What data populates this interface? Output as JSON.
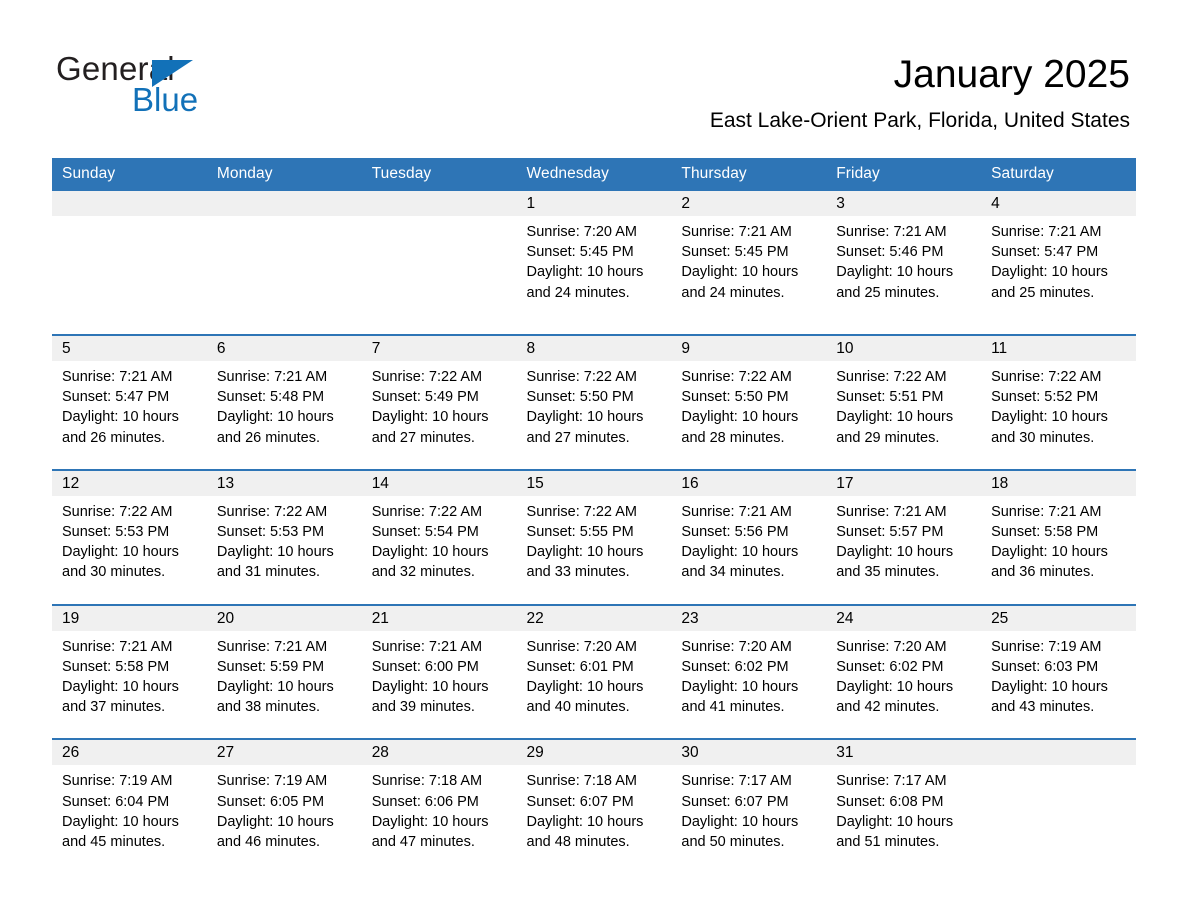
{
  "brand": {
    "name_part1": "General",
    "name_part2": "Blue",
    "accent_color": "#1271b8",
    "triangle_icon": "logo-triangle-icon"
  },
  "header": {
    "title": "January 2025",
    "location": "East Lake-Orient Park, Florida, United States"
  },
  "calendar": {
    "header_bg": "#2e75b6",
    "daynum_bg": "#f0f0f0",
    "columns": [
      "Sunday",
      "Monday",
      "Tuesday",
      "Wednesday",
      "Thursday",
      "Friday",
      "Saturday"
    ],
    "weeks": [
      [
        {
          "day": "",
          "lines": []
        },
        {
          "day": "",
          "lines": []
        },
        {
          "day": "",
          "lines": []
        },
        {
          "day": "1",
          "lines": [
            "Sunrise: 7:20 AM",
            "Sunset: 5:45 PM",
            "Daylight: 10 hours",
            "and 24 minutes."
          ]
        },
        {
          "day": "2",
          "lines": [
            "Sunrise: 7:21 AM",
            "Sunset: 5:45 PM",
            "Daylight: 10 hours",
            "and 24 minutes."
          ]
        },
        {
          "day": "3",
          "lines": [
            "Sunrise: 7:21 AM",
            "Sunset: 5:46 PM",
            "Daylight: 10 hours",
            "and 25 minutes."
          ]
        },
        {
          "day": "4",
          "lines": [
            "Sunrise: 7:21 AM",
            "Sunset: 5:47 PM",
            "Daylight: 10 hours",
            "and 25 minutes."
          ]
        }
      ],
      [
        {
          "day": "5",
          "lines": [
            "Sunrise: 7:21 AM",
            "Sunset: 5:47 PM",
            "Daylight: 10 hours",
            "and 26 minutes."
          ]
        },
        {
          "day": "6",
          "lines": [
            "Sunrise: 7:21 AM",
            "Sunset: 5:48 PM",
            "Daylight: 10 hours",
            "and 26 minutes."
          ]
        },
        {
          "day": "7",
          "lines": [
            "Sunrise: 7:22 AM",
            "Sunset: 5:49 PM",
            "Daylight: 10 hours",
            "and 27 minutes."
          ]
        },
        {
          "day": "8",
          "lines": [
            "Sunrise: 7:22 AM",
            "Sunset: 5:50 PM",
            "Daylight: 10 hours",
            "and 27 minutes."
          ]
        },
        {
          "day": "9",
          "lines": [
            "Sunrise: 7:22 AM",
            "Sunset: 5:50 PM",
            "Daylight: 10 hours",
            "and 28 minutes."
          ]
        },
        {
          "day": "10",
          "lines": [
            "Sunrise: 7:22 AM",
            "Sunset: 5:51 PM",
            "Daylight: 10 hours",
            "and 29 minutes."
          ]
        },
        {
          "day": "11",
          "lines": [
            "Sunrise: 7:22 AM",
            "Sunset: 5:52 PM",
            "Daylight: 10 hours",
            "and 30 minutes."
          ]
        }
      ],
      [
        {
          "day": "12",
          "lines": [
            "Sunrise: 7:22 AM",
            "Sunset: 5:53 PM",
            "Daylight: 10 hours",
            "and 30 minutes."
          ]
        },
        {
          "day": "13",
          "lines": [
            "Sunrise: 7:22 AM",
            "Sunset: 5:53 PM",
            "Daylight: 10 hours",
            "and 31 minutes."
          ]
        },
        {
          "day": "14",
          "lines": [
            "Sunrise: 7:22 AM",
            "Sunset: 5:54 PM",
            "Daylight: 10 hours",
            "and 32 minutes."
          ]
        },
        {
          "day": "15",
          "lines": [
            "Sunrise: 7:22 AM",
            "Sunset: 5:55 PM",
            "Daylight: 10 hours",
            "and 33 minutes."
          ]
        },
        {
          "day": "16",
          "lines": [
            "Sunrise: 7:21 AM",
            "Sunset: 5:56 PM",
            "Daylight: 10 hours",
            "and 34 minutes."
          ]
        },
        {
          "day": "17",
          "lines": [
            "Sunrise: 7:21 AM",
            "Sunset: 5:57 PM",
            "Daylight: 10 hours",
            "and 35 minutes."
          ]
        },
        {
          "day": "18",
          "lines": [
            "Sunrise: 7:21 AM",
            "Sunset: 5:58 PM",
            "Daylight: 10 hours",
            "and 36 minutes."
          ]
        }
      ],
      [
        {
          "day": "19",
          "lines": [
            "Sunrise: 7:21 AM",
            "Sunset: 5:58 PM",
            "Daylight: 10 hours",
            "and 37 minutes."
          ]
        },
        {
          "day": "20",
          "lines": [
            "Sunrise: 7:21 AM",
            "Sunset: 5:59 PM",
            "Daylight: 10 hours",
            "and 38 minutes."
          ]
        },
        {
          "day": "21",
          "lines": [
            "Sunrise: 7:21 AM",
            "Sunset: 6:00 PM",
            "Daylight: 10 hours",
            "and 39 minutes."
          ]
        },
        {
          "day": "22",
          "lines": [
            "Sunrise: 7:20 AM",
            "Sunset: 6:01 PM",
            "Daylight: 10 hours",
            "and 40 minutes."
          ]
        },
        {
          "day": "23",
          "lines": [
            "Sunrise: 7:20 AM",
            "Sunset: 6:02 PM",
            "Daylight: 10 hours",
            "and 41 minutes."
          ]
        },
        {
          "day": "24",
          "lines": [
            "Sunrise: 7:20 AM",
            "Sunset: 6:02 PM",
            "Daylight: 10 hours",
            "and 42 minutes."
          ]
        },
        {
          "day": "25",
          "lines": [
            "Sunrise: 7:19 AM",
            "Sunset: 6:03 PM",
            "Daylight: 10 hours",
            "and 43 minutes."
          ]
        }
      ],
      [
        {
          "day": "26",
          "lines": [
            "Sunrise: 7:19 AM",
            "Sunset: 6:04 PM",
            "Daylight: 10 hours",
            "and 45 minutes."
          ]
        },
        {
          "day": "27",
          "lines": [
            "Sunrise: 7:19 AM",
            "Sunset: 6:05 PM",
            "Daylight: 10 hours",
            "and 46 minutes."
          ]
        },
        {
          "day": "28",
          "lines": [
            "Sunrise: 7:18 AM",
            "Sunset: 6:06 PM",
            "Daylight: 10 hours",
            "and 47 minutes."
          ]
        },
        {
          "day": "29",
          "lines": [
            "Sunrise: 7:18 AM",
            "Sunset: 6:07 PM",
            "Daylight: 10 hours",
            "and 48 minutes."
          ]
        },
        {
          "day": "30",
          "lines": [
            "Sunrise: 7:17 AM",
            "Sunset: 6:07 PM",
            "Daylight: 10 hours",
            "and 50 minutes."
          ]
        },
        {
          "day": "31",
          "lines": [
            "Sunrise: 7:17 AM",
            "Sunset: 6:08 PM",
            "Daylight: 10 hours",
            "and 51 minutes."
          ]
        },
        {
          "day": "",
          "lines": []
        }
      ]
    ]
  }
}
